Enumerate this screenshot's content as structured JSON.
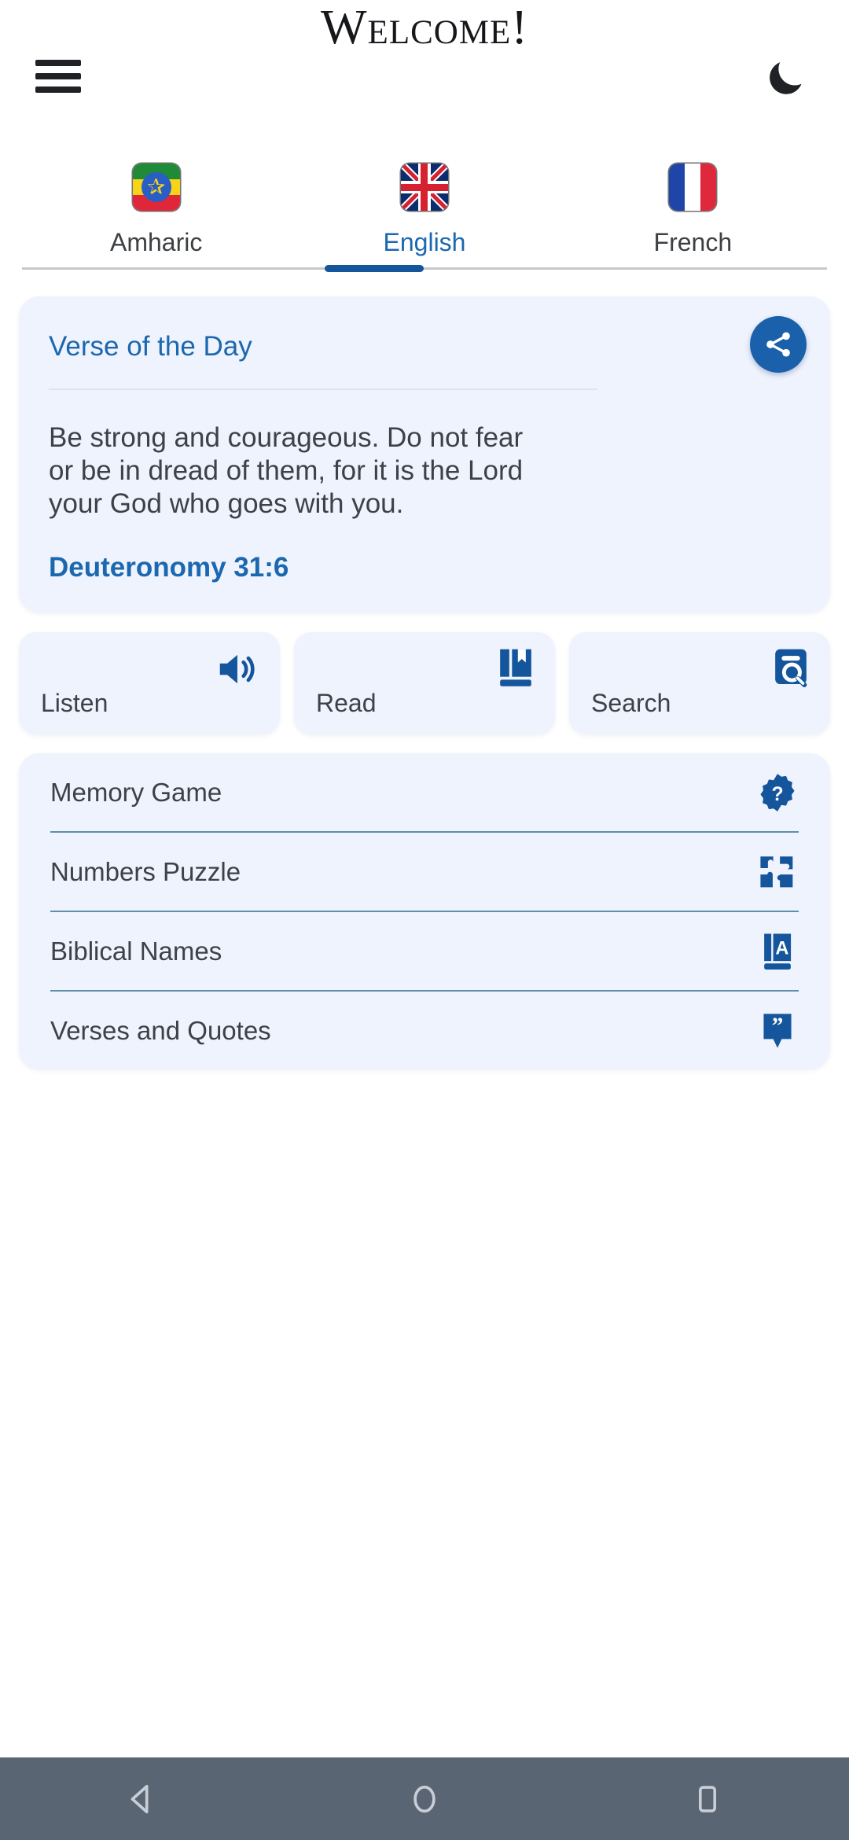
{
  "appbar": {
    "menu_icon": "hamburger-menu-icon",
    "theme_icon": "moon-icon",
    "title": "Welcome!"
  },
  "language_tabs": {
    "selected": "English",
    "items": [
      {
        "label": "Amharic",
        "flag": "flag-ethiopia",
        "active": false
      },
      {
        "label": "English",
        "flag": "flag-united-kingdom",
        "active": true
      },
      {
        "label": "French",
        "flag": "flag-france",
        "active": false
      }
    ]
  },
  "verse_card": {
    "heading": "Verse of the Day",
    "text": "Be strong and courageous. Do not fear or be in dread of them, for it is the Lord your God who goes with you.",
    "reference": "Deuteronomy 31:6",
    "share_icon": "share-icon"
  },
  "action_tiles": [
    {
      "label": "Listen",
      "icon": "volume-speaker-icon"
    },
    {
      "label": "Read",
      "icon": "book-bookmark-icon"
    },
    {
      "label": "Search",
      "icon": "book-search-icon"
    }
  ],
  "menu_list": [
    {
      "label": "Memory Game",
      "icon": "question-badge-icon"
    },
    {
      "label": "Numbers Puzzle",
      "icon": "puzzle-pieces-icon"
    },
    {
      "label": "Biblical Names",
      "icon": "book-letter-a-icon"
    },
    {
      "label": "Verses and Quotes",
      "icon": "quote-bubble-icon"
    }
  ],
  "navbar": [
    {
      "name": "back",
      "icon": "triangle-back-icon"
    },
    {
      "name": "home",
      "icon": "circle-home-icon"
    },
    {
      "name": "recents",
      "icon": "square-recents-icon"
    }
  ],
  "colors": {
    "accent_blue": "#1b67b0",
    "fab_blue": "#1b60ab",
    "card_bg": "#eff3fd",
    "text_dark": "#3b4248",
    "navbar_bg": "#5a6574",
    "divider": "#2f6e8d"
  }
}
